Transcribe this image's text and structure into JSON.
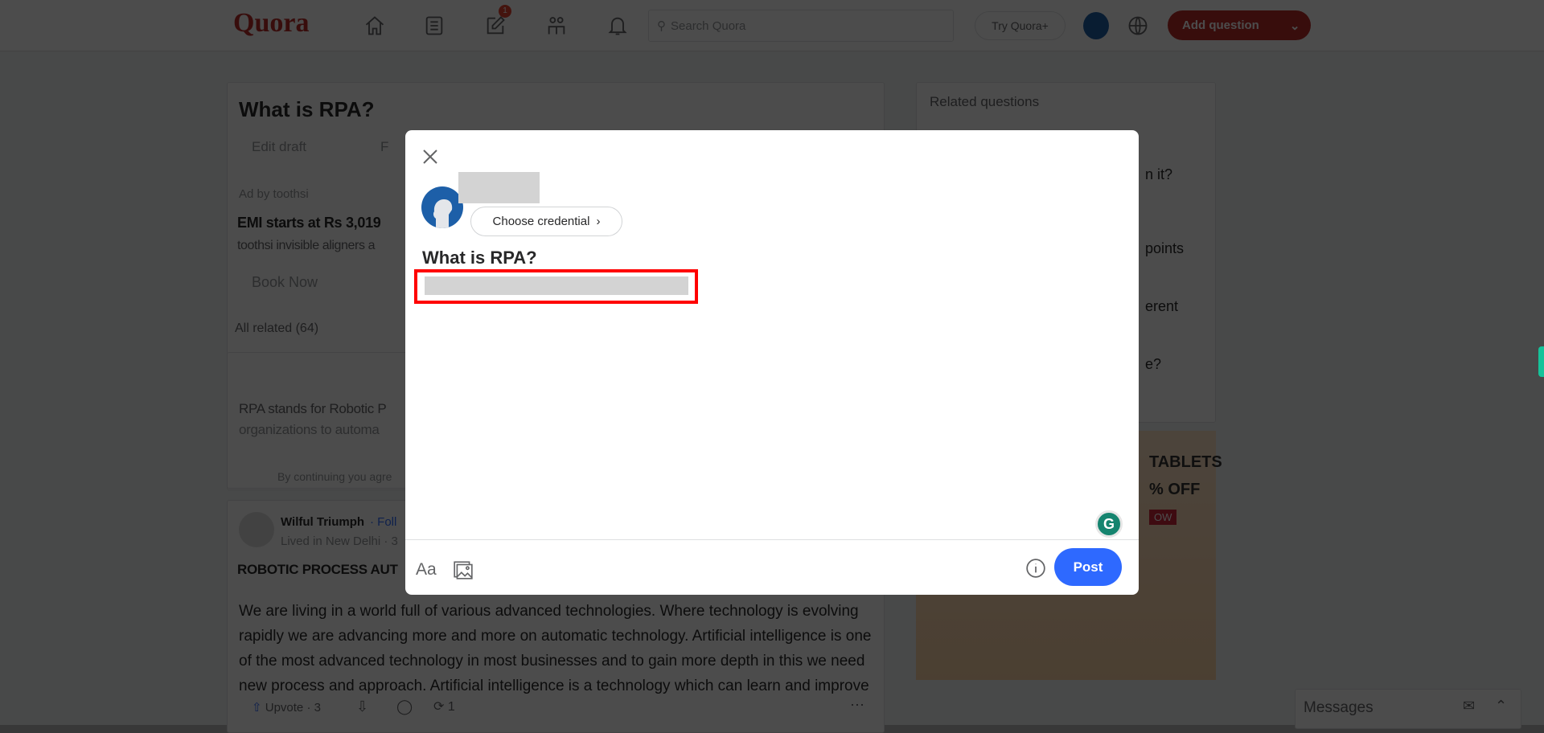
{
  "header": {
    "logo": "Quora",
    "notification_count": "1",
    "search_placeholder": "Search Quora",
    "try_plus": "Try Quora+",
    "add_question": "Add question"
  },
  "question": {
    "title": "What is RPA?",
    "edit_draft": "Edit draft",
    "follow": "F"
  },
  "ad": {
    "label": "Ad by toothsi",
    "headline": "EMI starts at Rs 3,019",
    "body": "toothsi invisible aligners a",
    "cta": "Book Now"
  },
  "all_related": "All related (64)",
  "ai_answer": {
    "line1": "RPA stands for Robotic P",
    "line2": "organizations to automa",
    "terms": "By continuing you agre"
  },
  "answer": {
    "author": "Wilful Triumph",
    "follow": "· Foll",
    "credential": "Lived in New Delhi · 3",
    "heading": "ROBOTIC PROCESS AUT",
    "body": [
      "We are living in a world full of various advanced technologies. Where technology is evolving",
      "rapidly we are advancing more and more on automatic technology. Artificial intelligence is one",
      "of the most advanced technology in most businesses and to gain more depth in this we need",
      "new process and approach. Artificial intelligence is a technology which can learn and improve"
    ],
    "upvote": "Upvote · 3",
    "share_count": "1"
  },
  "sidebar": {
    "title": "Related questions",
    "fragments": [
      "n it?",
      "points",
      "erent",
      "e?"
    ]
  },
  "sidebar_ad": {
    "line1": "TABLETS",
    "line2": "% OFF",
    "cta": "OW"
  },
  "modal": {
    "credential_button": "Choose credential",
    "question_title": "What is RPA?",
    "format_label": "Aa",
    "post_button": "Post"
  },
  "messages": {
    "label": "Messages"
  },
  "colors": {
    "brand": "#b92b27",
    "post": "#2e69ff",
    "highlight": "#ff0000",
    "grammarly": "#15846f"
  }
}
